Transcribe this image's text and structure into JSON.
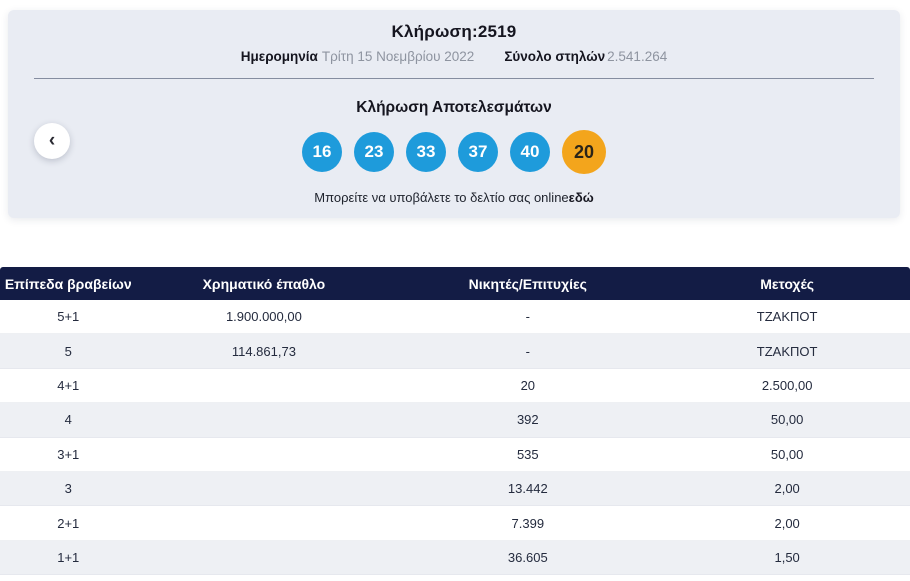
{
  "card": {
    "draw_title": "Κλήρωση:2519",
    "date_label": "Ημερομηνία",
    "date_value": "Τρίτη 15 Νοεμβρίου 2022",
    "total_columns_label": "Σύνολο στηλών",
    "total_columns_value": "2.541.264",
    "results_title": "Κλήρωση Αποτελεσμάτων",
    "winning_numbers": [
      "16",
      "23",
      "33",
      "37",
      "40"
    ],
    "bonus_number": "20",
    "submit_text": "Μπορείτε να υποβάλετε το δελτίο σας online",
    "submit_link_label": "εδώ",
    "prev_button_glyph": "‹"
  },
  "colors": {
    "number_ball_blue": "#1e9bdb",
    "bonus_ball_orange": "#f3a51c",
    "table_header_navy": "#131c45",
    "card_background": "#e9ecf3",
    "row_alternate": "#eef0f4"
  },
  "table": {
    "headers": [
      "Επίπεδα βραβείων",
      "Χρηματικό έπαθλο",
      "Νικητές/Επιτυχίες",
      "Μετοχές"
    ],
    "rows": [
      [
        "5+1",
        "1.900.000,00",
        "-",
        "ΤΖΑΚΠΟΤ"
      ],
      [
        "5",
        "114.861,73",
        "-",
        "ΤΖΑΚΠΟΤ"
      ],
      [
        "4+1",
        "",
        "20",
        "2.500,00"
      ],
      [
        "4",
        "",
        "392",
        "50,00"
      ],
      [
        "3+1",
        "",
        "535",
        "50,00"
      ],
      [
        "3",
        "",
        "13.442",
        "2,00"
      ],
      [
        "2+1",
        "",
        "7.399",
        "2,00"
      ],
      [
        "1+1",
        "",
        "36.605",
        "1,50"
      ]
    ]
  }
}
